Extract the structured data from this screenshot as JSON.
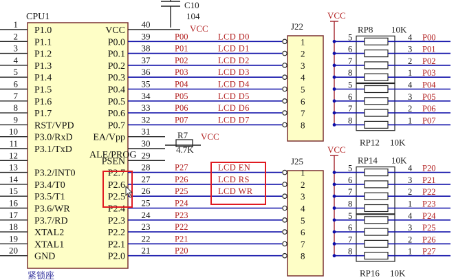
{
  "cpu": {
    "title": "CPU1",
    "left_pins": [
      {
        "num": "1",
        "label": "P1.0"
      },
      {
        "num": "2",
        "label": "P1.1"
      },
      {
        "num": "3",
        "label": "P1.2"
      },
      {
        "num": "4",
        "label": "P1.3"
      },
      {
        "num": "5",
        "label": "P1.4"
      },
      {
        "num": "6",
        "label": "P1.5"
      },
      {
        "num": "7",
        "label": "P1.6"
      },
      {
        "num": "8",
        "label": "P1.7"
      },
      {
        "num": "9",
        "label": "RST/VPD"
      },
      {
        "num": "10",
        "label": "P3.0/RxD"
      },
      {
        "num": "11",
        "label": "P3.1/TxD"
      },
      {
        "num": "12",
        "label": ""
      },
      {
        "num": "13",
        "label": "P3.2/INT0"
      },
      {
        "num": "14",
        "label": "P3.4/T0"
      },
      {
        "num": "15",
        "label": "P3.5/T1"
      },
      {
        "num": "16",
        "label": "P3.6/WR"
      },
      {
        "num": "17",
        "label": "P3.7/RD"
      },
      {
        "num": "18",
        "label": "XTAL2"
      },
      {
        "num": "19",
        "label": "XTAL1"
      },
      {
        "num": "20",
        "label": "GND"
      }
    ],
    "right_pins": [
      {
        "num": "40",
        "label": "VCC",
        "net": "VCC"
      },
      {
        "num": "39",
        "label": "P0.0",
        "net": "P00"
      },
      {
        "num": "38",
        "label": "P0.1",
        "net": "P01"
      },
      {
        "num": "37",
        "label": "P0.2",
        "net": "P02"
      },
      {
        "num": "36",
        "label": "P0.3",
        "net": "P03"
      },
      {
        "num": "35",
        "label": "P0.4",
        "net": "P04"
      },
      {
        "num": "34",
        "label": "P0.5",
        "net": "P05"
      },
      {
        "num": "33",
        "label": "P0.6",
        "net": "P06"
      },
      {
        "num": "32",
        "label": "P0.7",
        "net": "P07"
      },
      {
        "num": "31",
        "label": "EA/Vpp",
        "net": ""
      },
      {
        "num": "30",
        "label": "ALE/PROG",
        "net": ""
      },
      {
        "num": "29",
        "label": "PSEN",
        "net": ""
      },
      {
        "num": "28",
        "label": "P2.7",
        "net": "P27"
      },
      {
        "num": "27",
        "label": "P2.6",
        "net": "P26"
      },
      {
        "num": "26",
        "label": "P2.5",
        "net": "P25"
      },
      {
        "num": "25",
        "label": "P2.4",
        "net": "P24"
      },
      {
        "num": "24",
        "label": "P2.3",
        "net": "P23"
      },
      {
        "num": "23",
        "label": "P2.2",
        "net": "P22"
      },
      {
        "num": "22",
        "label": "P2.1",
        "net": "P21"
      },
      {
        "num": "21",
        "label": "P2.0",
        "net": "P20"
      }
    ],
    "socket_label": "紧锁座"
  },
  "capacitor": {
    "ref": "C10",
    "value": "104",
    "net": "VCC"
  },
  "resistor": {
    "ref": "R7",
    "value": "4.7K",
    "net": "VCC"
  },
  "lcd_data_labels": [
    "LCD_D0",
    "LCD_D1",
    "LCD_D2",
    "LCD_D3",
    "LCD_D4",
    "LCD_D5",
    "LCD_D6",
    "LCD_D7"
  ],
  "lcd_ctrl_labels": [
    "LCD_EN",
    "LCD_RS",
    "LCD_WR"
  ],
  "connectors": [
    {
      "ref": "J22",
      "pins": [
        "1",
        "2",
        "3",
        "4",
        "5",
        "6",
        "7",
        "8"
      ]
    },
    {
      "ref": "J25",
      "pins": [
        "1",
        "2",
        "3",
        "4",
        "5",
        "6",
        "7",
        "8"
      ]
    }
  ],
  "resistor_networks": {
    "top": {
      "vcc": "VCC",
      "refs": [
        "RP8",
        "RP12"
      ],
      "value": "10K",
      "left_pins": [
        "5",
        "6",
        "7",
        "8",
        "5",
        "6",
        "7",
        "8"
      ],
      "right_pins": [
        "4",
        "3",
        "2",
        "1",
        "4",
        "3",
        "2",
        "1"
      ],
      "nets": [
        "P00",
        "P01",
        "P02",
        "P03",
        "P04",
        "P05",
        "P06",
        "P07"
      ]
    },
    "bottom": {
      "vcc": "VCC",
      "refs": [
        "RP14",
        "RP16"
      ],
      "value": "10K",
      "left_pins": [
        "5",
        "6",
        "7",
        "8",
        "5",
        "6",
        "7",
        "8"
      ],
      "right_pins": [
        "4",
        "3",
        "2",
        "1",
        "4",
        "3",
        "2",
        "1"
      ],
      "nets": [
        "P20",
        "P21",
        "P22",
        "P23",
        "P24",
        "P25",
        "P26",
        "P27"
      ]
    }
  },
  "colors": {
    "wire": "#0f0fa8",
    "net_text": "#b22020",
    "highlight": "#e01b22",
    "chip_fill": "#fefec6"
  }
}
